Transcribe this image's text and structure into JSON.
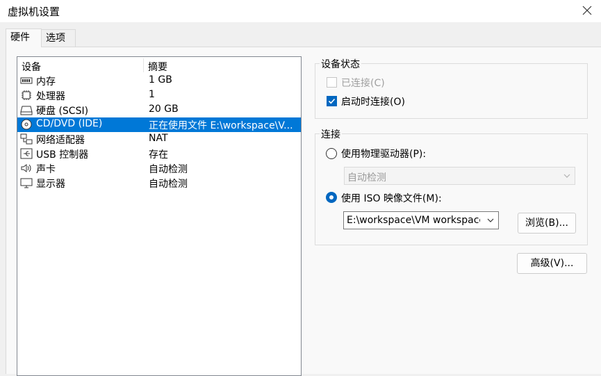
{
  "window": {
    "title": "虚拟机设置"
  },
  "tabs": [
    {
      "label": "硬件"
    },
    {
      "label": "选项"
    }
  ],
  "device_table": {
    "columns": [
      "设备",
      "摘要"
    ],
    "rows": [
      {
        "icon": "memory-icon",
        "name": "内存",
        "summary": "1 GB"
      },
      {
        "icon": "processor-icon",
        "name": "处理器",
        "summary": "1"
      },
      {
        "icon": "hard-disk-icon",
        "name": "硬盘 (SCSI)",
        "summary": "20 GB"
      },
      {
        "icon": "cd-dvd-icon",
        "name": "CD/DVD (IDE)",
        "summary": "正在使用文件 E:\\workspace\\V...",
        "selected": true
      },
      {
        "icon": "network-adapter-icon",
        "name": "网络适配器",
        "summary": "NAT"
      },
      {
        "icon": "usb-icon",
        "name": "USB 控制器",
        "summary": "存在"
      },
      {
        "icon": "sound-card-icon",
        "name": "声卡",
        "summary": "自动检测"
      },
      {
        "icon": "display-icon",
        "name": "显示器",
        "summary": "自动检测"
      }
    ]
  },
  "device_status": {
    "label": "设备状态",
    "connected": {
      "label": "已连接(C)",
      "checked": false,
      "disabled": true
    },
    "connect_at_power_on": {
      "label": "启动时连接(O)",
      "checked": true
    }
  },
  "connection": {
    "label": "连接",
    "physical_drive": {
      "label": "使用物理驱动器(P):",
      "selected": false
    },
    "physical_drive_select": {
      "value": "自动检测",
      "disabled": true
    },
    "iso_image": {
      "label": "使用 ISO 映像文件(M):",
      "selected": true
    },
    "iso_path": {
      "value": "E:\\workspace\\VM workspace\\r"
    },
    "browse_button": "浏览(B)..."
  },
  "advanced_button": "高级(V)...",
  "colors": {
    "selection": "#0078d7",
    "accent": "#0067c0"
  }
}
